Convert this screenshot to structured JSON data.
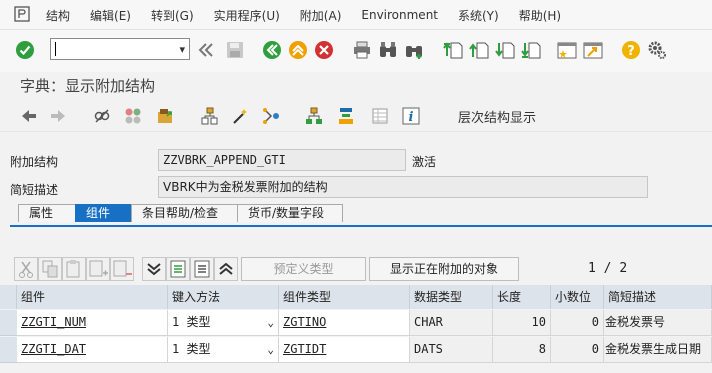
{
  "menu": {
    "items": [
      "结构",
      "编辑(E)",
      "转到(G)",
      "实用程序(U)",
      "附加(A)",
      "Environment",
      "系统(Y)",
      "帮助(H)"
    ]
  },
  "toolbar1": {
    "command_value": "",
    "icons": [
      "check-icon",
      "command-field",
      "back-double-icon",
      "save-icon",
      "back-icon",
      "exit-icon",
      "cancel-icon",
      "print-icon",
      "find-icon",
      "find-next-icon",
      "first-page-icon",
      "prev-page-icon",
      "next-page-icon",
      "last-page-icon",
      "new-session-icon",
      "shortcut-icon",
      "help-icon",
      "settings-icon"
    ]
  },
  "page": {
    "title": "字典：显示附加结构"
  },
  "toolbar2": {
    "hierarchy_label": "层次结构显示"
  },
  "form": {
    "append_label": "附加结构",
    "append_value": "ZZVBRK_APPEND_GTI",
    "status": "激活",
    "desc_label": "简短描述",
    "desc_value": "VBRK中为金税发票附加的结构"
  },
  "tabs": [
    "属性",
    "组件",
    "条目帮助/检查",
    "货币/数量字段"
  ],
  "active_tab": "组件",
  "table_toolbar": {
    "predefined_type": "预定义类型",
    "show_appended": "显示正在附加的对象",
    "page_current": "1",
    "page_sep": "/",
    "page_total": "2"
  },
  "table": {
    "columns": [
      "组件",
      "键入方法",
      "组件类型",
      "数据类型",
      "长度",
      "小数位",
      "简短描述"
    ],
    "rows": [
      {
        "component": "ZZGTI_NUM",
        "method_num": "1",
        "method": "类型",
        "comp_type": "ZGTINO",
        "data_type": "CHAR",
        "length": "10",
        "decimals": "0",
        "desc": "金税发票号"
      },
      {
        "component": "ZZGTI_DAT",
        "method_num": "1",
        "method": "类型",
        "comp_type": "ZGTIDT",
        "data_type": "DATS",
        "length": "8",
        "decimals": "0",
        "desc": "金税发票生成日期"
      }
    ]
  },
  "colors": {
    "accent": "#1870c4",
    "check_green": "#2e9e3e",
    "nav_orange": "#f0a000",
    "cancel_red": "#d23232",
    "help_yellow": "#f0b400"
  }
}
